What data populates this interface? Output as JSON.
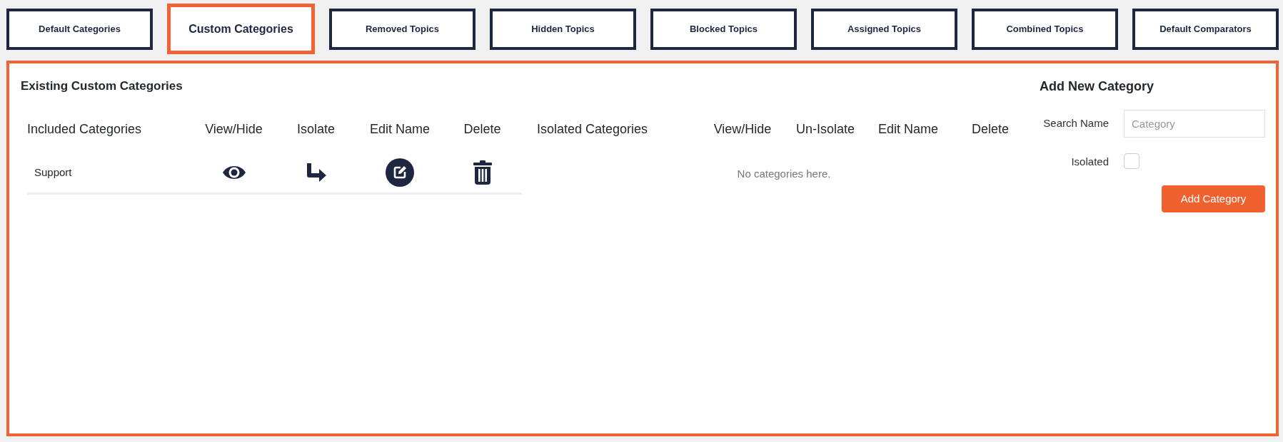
{
  "tabs": [
    {
      "label": "Default Categories",
      "selected": false
    },
    {
      "label": "Custom Categories",
      "selected": true
    },
    {
      "label": "Removed Topics",
      "selected": false
    },
    {
      "label": "Hidden Topics",
      "selected": false
    },
    {
      "label": "Blocked Topics",
      "selected": false
    },
    {
      "label": "Assigned Topics",
      "selected": false
    },
    {
      "label": "Combined Topics",
      "selected": false
    },
    {
      "label": "Default Comparators",
      "selected": false
    }
  ],
  "existing": {
    "title": "Existing Custom Categories",
    "included_table": {
      "columns": [
        "Included Categories",
        "View/Hide",
        "Isolate",
        "Edit Name",
        "Delete"
      ],
      "rows": [
        {
          "name": "Support"
        }
      ]
    },
    "isolated_table": {
      "columns": [
        "Isolated Categories",
        "View/Hide",
        "Un-Isolate",
        "Edit Name",
        "Delete"
      ],
      "empty_message": "No categories here."
    }
  },
  "add_form": {
    "title": "Add New Category",
    "fields": [
      {
        "kind": "text",
        "label": "Search Name",
        "placeholder": "Category"
      },
      {
        "kind": "checkbox",
        "label": "Isolated",
        "checked": false
      }
    ],
    "submit": "Add Category"
  }
}
